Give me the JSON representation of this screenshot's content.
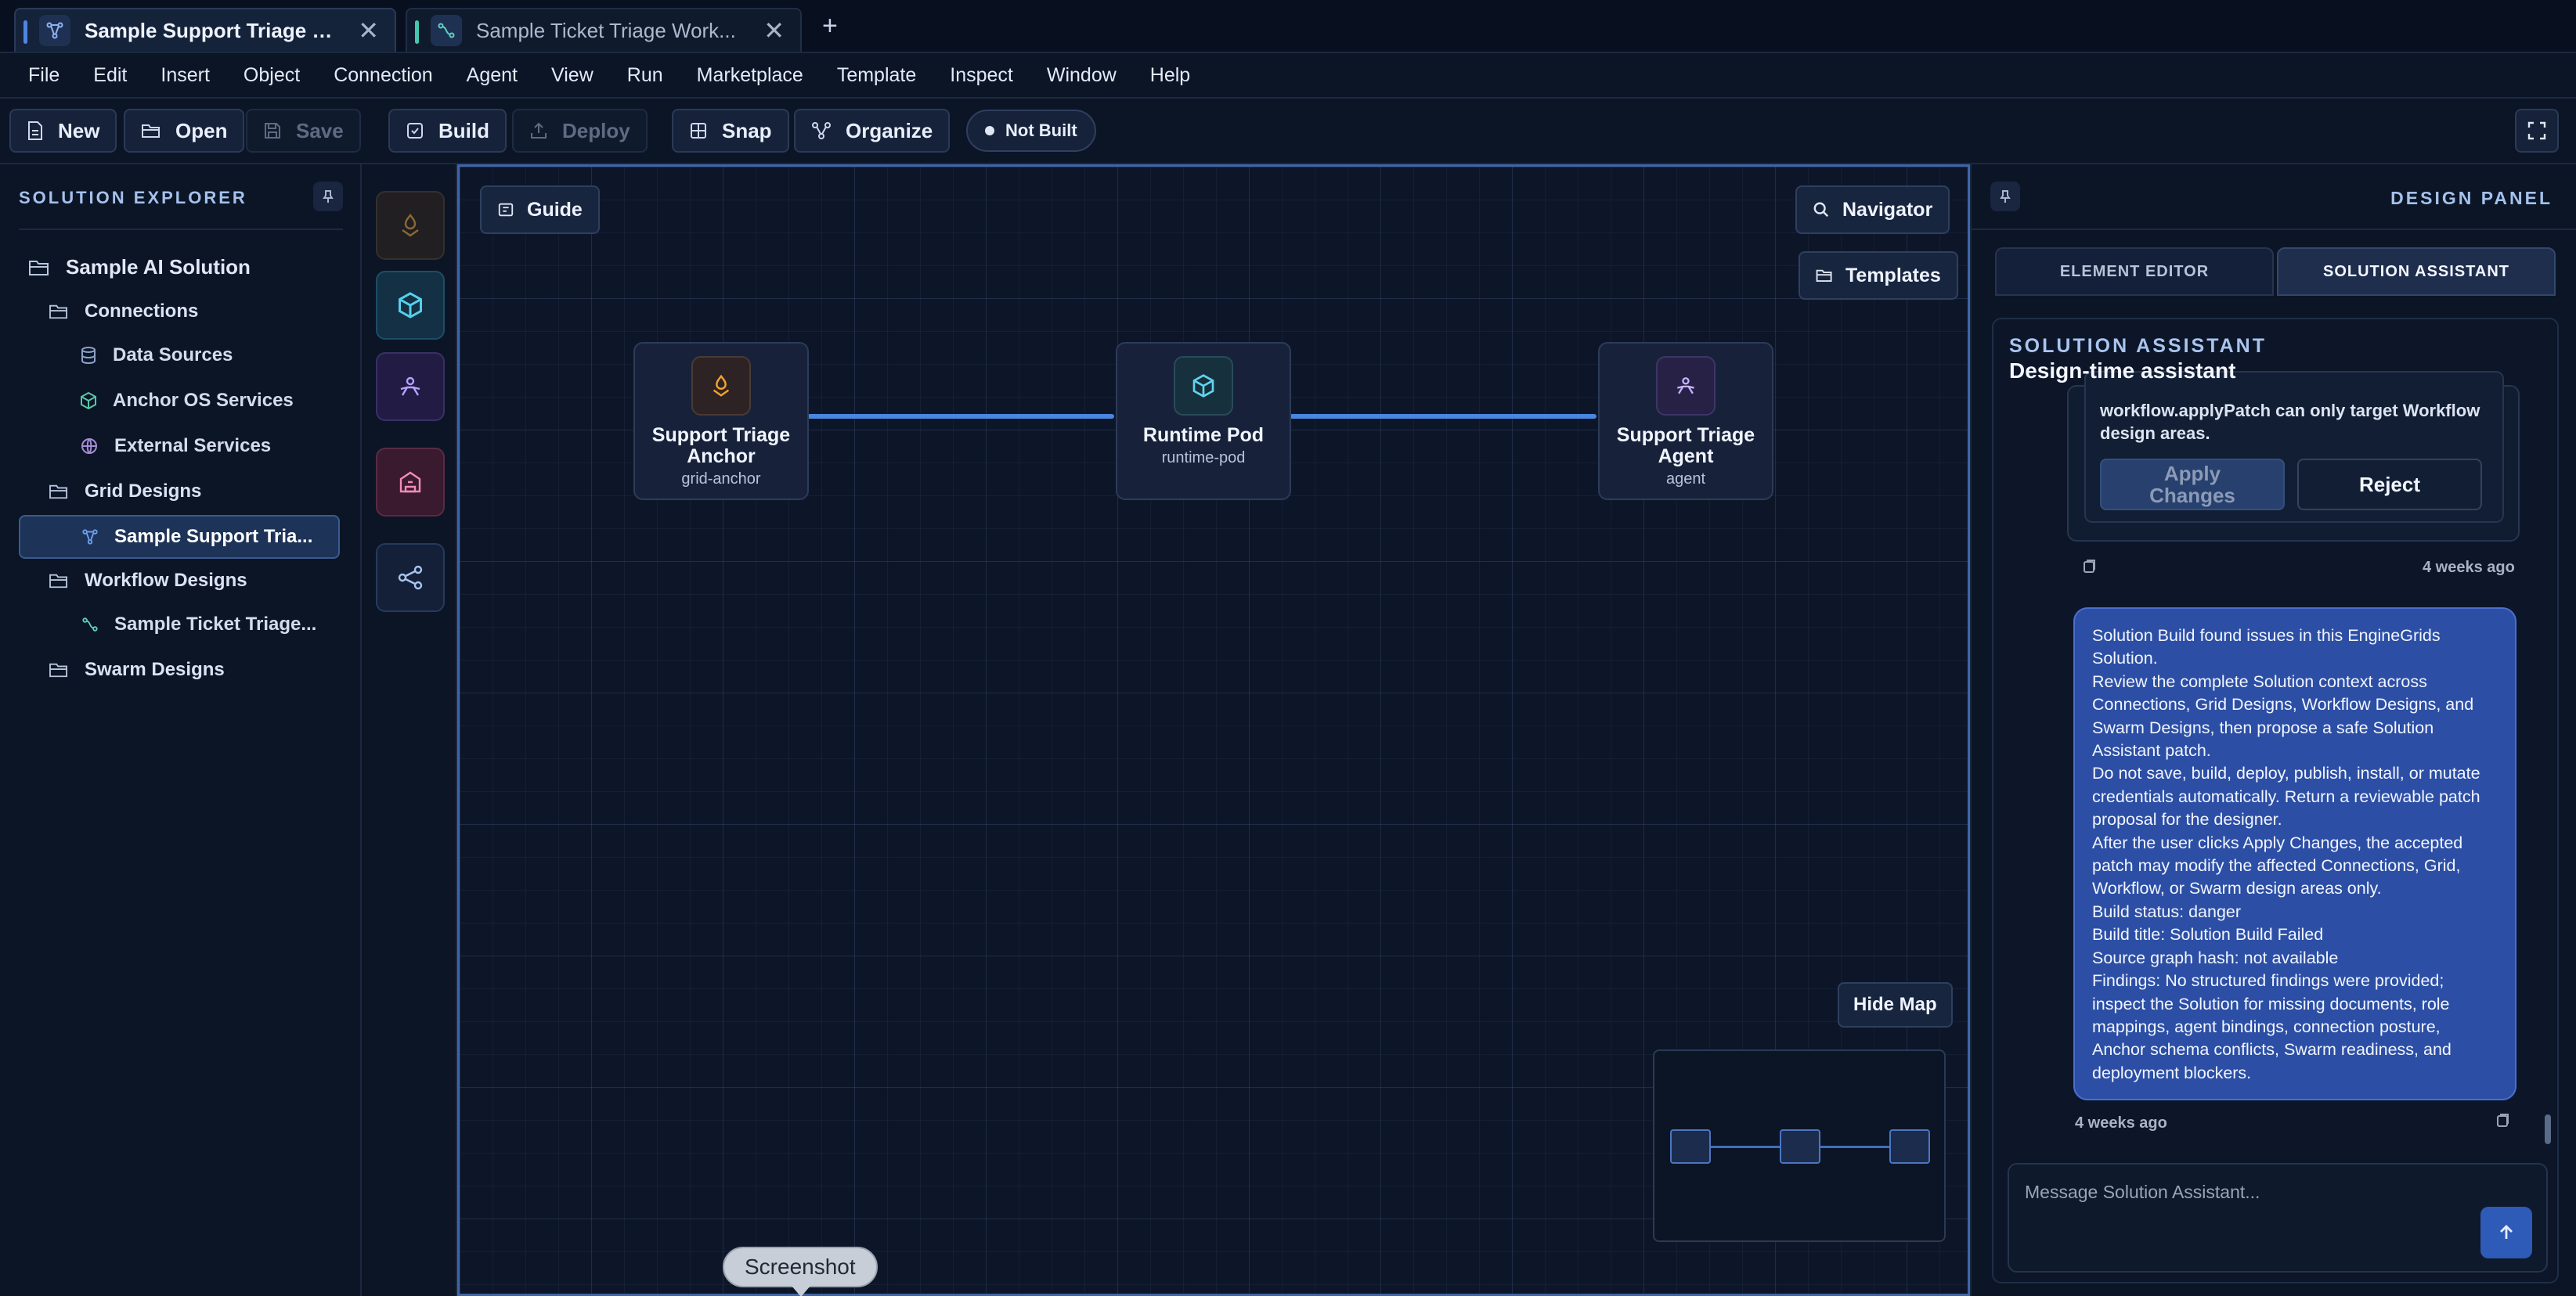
{
  "tabs": [
    {
      "label": "Sample Support Triage Gri...",
      "close": "✕"
    },
    {
      "label": "Sample Ticket Triage Work...",
      "close": "✕"
    }
  ],
  "new_tab": "+",
  "menu": [
    "File",
    "Edit",
    "Insert",
    "Object",
    "Connection",
    "Agent",
    "View",
    "Run",
    "Marketplace",
    "Template",
    "Inspect",
    "Window",
    "Help"
  ],
  "toolbar": {
    "new": "New",
    "open": "Open",
    "save": "Save",
    "build": "Build",
    "deploy": "Deploy",
    "snap": "Snap",
    "organize": "Organize",
    "status": "Not Built"
  },
  "explorer": {
    "title": "SOLUTION EXPLORER",
    "root": "Sample AI Solution",
    "connections": "Connections",
    "data_sources": "Data Sources",
    "anchor_os": "Anchor OS Services",
    "external": "External Services",
    "grid_designs": "Grid Designs",
    "grid_item": "Sample Support Tria...",
    "workflow_designs": "Workflow Designs",
    "workflow_item": "Sample Ticket Triage...",
    "swarm_designs": "Swarm Designs"
  },
  "canvas": {
    "guide": "Guide",
    "navigator": "Navigator",
    "templates": "Templates",
    "hide_map": "Hide Map",
    "nodes": [
      {
        "title1": "Support Triage",
        "title2": "Anchor",
        "sub": "grid-anchor"
      },
      {
        "title1": "Runtime Pod",
        "title2": "",
        "sub": "runtime-pod"
      },
      {
        "title1": "Support Triage",
        "title2": "Agent",
        "sub": "agent"
      }
    ],
    "screenshot": "Screenshot"
  },
  "panel": {
    "title": "DESIGN PANEL",
    "tab_element": "ELEMENT EDITOR",
    "tab_assistant": "SOLUTION ASSISTANT",
    "chat_title": "SOLUTION ASSISTANT",
    "chat_subtitle": "Design-time assistant",
    "assistant_text": "workflow.applyPatch can only target Workflow design areas.",
    "apply_line1": "Apply",
    "apply_line2": "Changes",
    "reject": "Reject",
    "assistant_time": "4 weeks ago",
    "user_lines": [
      "Solution Build found issues in this EngineGrids",
      "Solution.",
      "Review the complete Solution context across",
      "Connections, Grid Designs, Workflow Designs, and",
      "Swarm Designs, then propose a safe Solution",
      "Assistant patch.",
      "Do not save, build, deploy, publish, install, or mutate",
      "credentials automatically. Return a reviewable patch",
      "proposal for the designer.",
      "After the user clicks Apply Changes, the accepted",
      "patch may modify the affected Connections, Grid,",
      "Workflow, or Swarm design areas only.",
      "Build status: danger",
      "Build title: Solution Build Failed",
      "Source graph hash: not available",
      "Findings: No structured findings were provided;",
      "inspect the Solution for missing documents, role",
      "mappings, agent bindings, connection posture,",
      "Anchor schema conflicts, Swarm readiness, and",
      "deployment blockers."
    ],
    "user_time": "4 weeks ago",
    "input_placeholder": "Message Solution Assistant..."
  }
}
